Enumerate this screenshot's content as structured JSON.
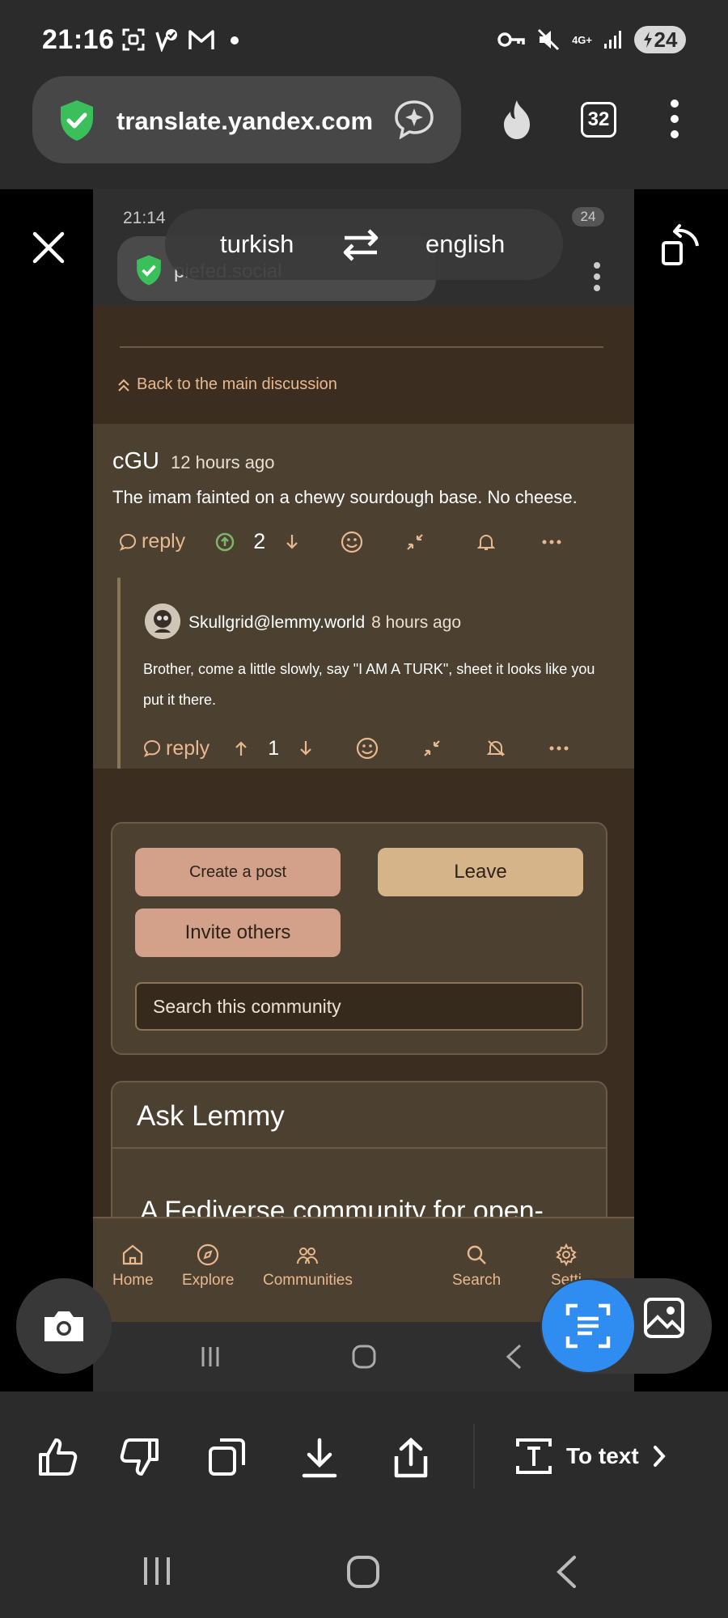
{
  "status_bar": {
    "time": "21:16",
    "network": "4G+",
    "battery": "24"
  },
  "browser": {
    "url": "translate.yandex.com",
    "tab_count": "32"
  },
  "translation": {
    "source_lang": "turkish",
    "target_lang": "english"
  },
  "inner": {
    "status_time": "21:14",
    "battery": "24",
    "url": "piefed.social",
    "back_link": "Back to the main discussion",
    "comment": {
      "user": "cGU",
      "time": "12 hours ago",
      "body": "The imam fainted on a chewy sourdough base. No cheese.",
      "reply_label": "reply",
      "votes": "2"
    },
    "reply": {
      "user": "Skullgrid@lemmy.world",
      "time": "8 hours ago",
      "body": "Brother, come a little slowly, say \"I AM A TURK\", sheet it looks like you put it there.",
      "reply_label": "reply",
      "votes": "1"
    },
    "sidebar": {
      "create_post": "Create a post",
      "leave": "Leave",
      "invite": "Invite others",
      "search_placeholder": "Search this community"
    },
    "about": {
      "title": "Ask Lemmy",
      "description": "A Fediverse community for open-"
    },
    "nav": {
      "home": "Home",
      "explore": "Explore",
      "communities": "Communities",
      "search": "Search",
      "settings": "Setti"
    }
  },
  "toolbar": {
    "to_text": "To text"
  },
  "colors": {
    "accent_blue": "#2f8cf0",
    "inner_bg": "#3b2e20",
    "card_bg": "#4c4030",
    "link": "#e8b88f"
  }
}
